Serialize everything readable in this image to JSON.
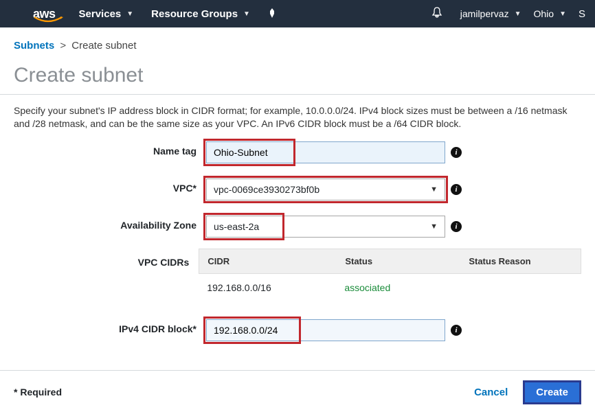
{
  "nav": {
    "services": "Services",
    "resource_groups": "Resource Groups",
    "user": "jamilpervaz",
    "region": "Ohio",
    "support_initial": "S"
  },
  "breadcrumb": {
    "root": "Subnets",
    "current": "Create subnet"
  },
  "page_title": "Create subnet",
  "description": "Specify your subnet's IP address block in CIDR format; for example, 10.0.0.0/24. IPv4 block sizes must be between a /16 netmask and /28 netmask, and can be the same size as your VPC. An IPv6 CIDR block must be a /64 CIDR block.",
  "form": {
    "name_tag": {
      "label": "Name tag",
      "value": "Ohio-Subnet"
    },
    "vpc": {
      "label": "VPC*",
      "selected": "vpc-0069ce3930273bf0b"
    },
    "az": {
      "label": "Availability Zone",
      "selected": "us-east-2a"
    },
    "vpc_cidrs_label": "VPC CIDRs",
    "table": {
      "headers": {
        "cidr": "CIDR",
        "status": "Status",
        "reason": "Status Reason"
      },
      "rows": [
        {
          "cidr": "192.168.0.0/16",
          "status": "associated",
          "reason": ""
        }
      ]
    },
    "ipv4": {
      "label": "IPv4 CIDR block*",
      "value": "192.168.0.0/24"
    }
  },
  "footer": {
    "required": "* Required",
    "cancel": "Cancel",
    "create": "Create"
  }
}
